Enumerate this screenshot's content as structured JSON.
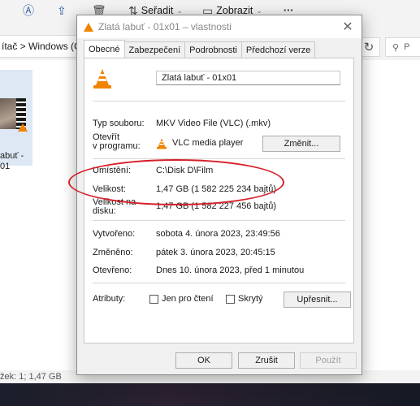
{
  "toolbar": {
    "sort_label": "Seřadit",
    "view_label": "Zobrazit",
    "more_label": "···"
  },
  "address": {
    "path": "ítač  >  Windows (C:",
    "search_placeholder": "P"
  },
  "file_tile": {
    "name_line1": "abuť -",
    "name_line2": "01"
  },
  "statusbar": {
    "text": "žek: 1; 1,47 GB"
  },
  "dialog": {
    "title": "Zlatá labuť - 01x01 – vlastnosti",
    "tabs": [
      "Obecné",
      "Zabezpečení",
      "Podrobnosti",
      "Předchozí verze"
    ],
    "file_name": "Zlatá labuť - 01x01",
    "type_label": "Typ souboru:",
    "type_value": "MKV Video File (VLC) (.mkv)",
    "opens_label_1": "Otevřít",
    "opens_label_2": "v programu:",
    "opens_value": "VLC media player",
    "change_button": "Změnit...",
    "location_label": "Umístění:",
    "location_value": "C:\\Disk D\\Film",
    "size_label": "Velikost:",
    "size_value": "1,47 GB (1 582 225 234 bajtů)",
    "disk_size_label_1": "Velikost na",
    "disk_size_label_2": "disku:",
    "disk_size_value": "1,47 GB (1 582 227 456 bajtů)",
    "created_label": "Vytvořeno:",
    "created_value": "sobota 4. února 2023, 23:49:56",
    "modified_label": "Změněno:",
    "modified_value": "pátek 3. února 2023, 20:45:15",
    "accessed_label": "Otevřeno:",
    "accessed_value": "Dnes 10. února 2023, před 1 minutou",
    "attributes_label": "Atributy:",
    "readonly_label": "Jen pro čtení",
    "hidden_label": "Skrytý",
    "advanced_button": "Upřesnit...",
    "ok_button": "OK",
    "cancel_button": "Zrušit",
    "apply_button": "Použít"
  },
  "colors": {
    "accent": "#2d5fa6",
    "vlc_orange": "#f08300",
    "highlight_oval": "#d6202a"
  }
}
